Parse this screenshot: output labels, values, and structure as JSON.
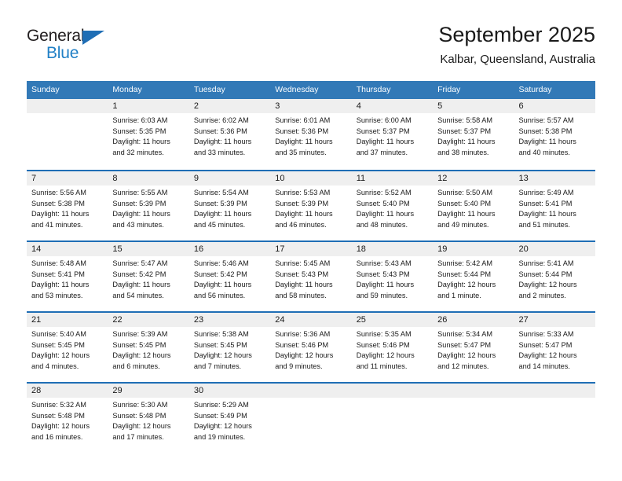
{
  "brand": {
    "name_top": "General",
    "name_bottom": "Blue",
    "color_dark": "#231f20",
    "color_blue": "#2180c6"
  },
  "header": {
    "title": "September 2025",
    "subtitle": "Kalbar, Queensland, Australia"
  },
  "theme": {
    "header_bg": "#3279b7",
    "header_text": "#ffffff",
    "week_divider": "#1f6eb5",
    "day_number_bg": "#efefef"
  },
  "weekdays": [
    "Sunday",
    "Monday",
    "Tuesday",
    "Wednesday",
    "Thursday",
    "Friday",
    "Saturday"
  ],
  "weeks": [
    [
      {
        "day": "",
        "sunrise": "",
        "sunset": "",
        "daylight_line1": "",
        "daylight_line2": ""
      },
      {
        "day": "1",
        "sunrise": "Sunrise: 6:03 AM",
        "sunset": "Sunset: 5:35 PM",
        "daylight_line1": "Daylight: 11 hours",
        "daylight_line2": "and 32 minutes."
      },
      {
        "day": "2",
        "sunrise": "Sunrise: 6:02 AM",
        "sunset": "Sunset: 5:36 PM",
        "daylight_line1": "Daylight: 11 hours",
        "daylight_line2": "and 33 minutes."
      },
      {
        "day": "3",
        "sunrise": "Sunrise: 6:01 AM",
        "sunset": "Sunset: 5:36 PM",
        "daylight_line1": "Daylight: 11 hours",
        "daylight_line2": "and 35 minutes."
      },
      {
        "day": "4",
        "sunrise": "Sunrise: 6:00 AM",
        "sunset": "Sunset: 5:37 PM",
        "daylight_line1": "Daylight: 11 hours",
        "daylight_line2": "and 37 minutes."
      },
      {
        "day": "5",
        "sunrise": "Sunrise: 5:58 AM",
        "sunset": "Sunset: 5:37 PM",
        "daylight_line1": "Daylight: 11 hours",
        "daylight_line2": "and 38 minutes."
      },
      {
        "day": "6",
        "sunrise": "Sunrise: 5:57 AM",
        "sunset": "Sunset: 5:38 PM",
        "daylight_line1": "Daylight: 11 hours",
        "daylight_line2": "and 40 minutes."
      }
    ],
    [
      {
        "day": "7",
        "sunrise": "Sunrise: 5:56 AM",
        "sunset": "Sunset: 5:38 PM",
        "daylight_line1": "Daylight: 11 hours",
        "daylight_line2": "and 41 minutes."
      },
      {
        "day": "8",
        "sunrise": "Sunrise: 5:55 AM",
        "sunset": "Sunset: 5:39 PM",
        "daylight_line1": "Daylight: 11 hours",
        "daylight_line2": "and 43 minutes."
      },
      {
        "day": "9",
        "sunrise": "Sunrise: 5:54 AM",
        "sunset": "Sunset: 5:39 PM",
        "daylight_line1": "Daylight: 11 hours",
        "daylight_line2": "and 45 minutes."
      },
      {
        "day": "10",
        "sunrise": "Sunrise: 5:53 AM",
        "sunset": "Sunset: 5:39 PM",
        "daylight_line1": "Daylight: 11 hours",
        "daylight_line2": "and 46 minutes."
      },
      {
        "day": "11",
        "sunrise": "Sunrise: 5:52 AM",
        "sunset": "Sunset: 5:40 PM",
        "daylight_line1": "Daylight: 11 hours",
        "daylight_line2": "and 48 minutes."
      },
      {
        "day": "12",
        "sunrise": "Sunrise: 5:50 AM",
        "sunset": "Sunset: 5:40 PM",
        "daylight_line1": "Daylight: 11 hours",
        "daylight_line2": "and 49 minutes."
      },
      {
        "day": "13",
        "sunrise": "Sunrise: 5:49 AM",
        "sunset": "Sunset: 5:41 PM",
        "daylight_line1": "Daylight: 11 hours",
        "daylight_line2": "and 51 minutes."
      }
    ],
    [
      {
        "day": "14",
        "sunrise": "Sunrise: 5:48 AM",
        "sunset": "Sunset: 5:41 PM",
        "daylight_line1": "Daylight: 11 hours",
        "daylight_line2": "and 53 minutes."
      },
      {
        "day": "15",
        "sunrise": "Sunrise: 5:47 AM",
        "sunset": "Sunset: 5:42 PM",
        "daylight_line1": "Daylight: 11 hours",
        "daylight_line2": "and 54 minutes."
      },
      {
        "day": "16",
        "sunrise": "Sunrise: 5:46 AM",
        "sunset": "Sunset: 5:42 PM",
        "daylight_line1": "Daylight: 11 hours",
        "daylight_line2": "and 56 minutes."
      },
      {
        "day": "17",
        "sunrise": "Sunrise: 5:45 AM",
        "sunset": "Sunset: 5:43 PM",
        "daylight_line1": "Daylight: 11 hours",
        "daylight_line2": "and 58 minutes."
      },
      {
        "day": "18",
        "sunrise": "Sunrise: 5:43 AM",
        "sunset": "Sunset: 5:43 PM",
        "daylight_line1": "Daylight: 11 hours",
        "daylight_line2": "and 59 minutes."
      },
      {
        "day": "19",
        "sunrise": "Sunrise: 5:42 AM",
        "sunset": "Sunset: 5:44 PM",
        "daylight_line1": "Daylight: 12 hours",
        "daylight_line2": "and 1 minute."
      },
      {
        "day": "20",
        "sunrise": "Sunrise: 5:41 AM",
        "sunset": "Sunset: 5:44 PM",
        "daylight_line1": "Daylight: 12 hours",
        "daylight_line2": "and 2 minutes."
      }
    ],
    [
      {
        "day": "21",
        "sunrise": "Sunrise: 5:40 AM",
        "sunset": "Sunset: 5:45 PM",
        "daylight_line1": "Daylight: 12 hours",
        "daylight_line2": "and 4 minutes."
      },
      {
        "day": "22",
        "sunrise": "Sunrise: 5:39 AM",
        "sunset": "Sunset: 5:45 PM",
        "daylight_line1": "Daylight: 12 hours",
        "daylight_line2": "and 6 minutes."
      },
      {
        "day": "23",
        "sunrise": "Sunrise: 5:38 AM",
        "sunset": "Sunset: 5:45 PM",
        "daylight_line1": "Daylight: 12 hours",
        "daylight_line2": "and 7 minutes."
      },
      {
        "day": "24",
        "sunrise": "Sunrise: 5:36 AM",
        "sunset": "Sunset: 5:46 PM",
        "daylight_line1": "Daylight: 12 hours",
        "daylight_line2": "and 9 minutes."
      },
      {
        "day": "25",
        "sunrise": "Sunrise: 5:35 AM",
        "sunset": "Sunset: 5:46 PM",
        "daylight_line1": "Daylight: 12 hours",
        "daylight_line2": "and 11 minutes."
      },
      {
        "day": "26",
        "sunrise": "Sunrise: 5:34 AM",
        "sunset": "Sunset: 5:47 PM",
        "daylight_line1": "Daylight: 12 hours",
        "daylight_line2": "and 12 minutes."
      },
      {
        "day": "27",
        "sunrise": "Sunrise: 5:33 AM",
        "sunset": "Sunset: 5:47 PM",
        "daylight_line1": "Daylight: 12 hours",
        "daylight_line2": "and 14 minutes."
      }
    ],
    [
      {
        "day": "28",
        "sunrise": "Sunrise: 5:32 AM",
        "sunset": "Sunset: 5:48 PM",
        "daylight_line1": "Daylight: 12 hours",
        "daylight_line2": "and 16 minutes."
      },
      {
        "day": "29",
        "sunrise": "Sunrise: 5:30 AM",
        "sunset": "Sunset: 5:48 PM",
        "daylight_line1": "Daylight: 12 hours",
        "daylight_line2": "and 17 minutes."
      },
      {
        "day": "30",
        "sunrise": "Sunrise: 5:29 AM",
        "sunset": "Sunset: 5:49 PM",
        "daylight_line1": "Daylight: 12 hours",
        "daylight_line2": "and 19 minutes."
      },
      {
        "day": "",
        "sunrise": "",
        "sunset": "",
        "daylight_line1": "",
        "daylight_line2": ""
      },
      {
        "day": "",
        "sunrise": "",
        "sunset": "",
        "daylight_line1": "",
        "daylight_line2": ""
      },
      {
        "day": "",
        "sunrise": "",
        "sunset": "",
        "daylight_line1": "",
        "daylight_line2": ""
      },
      {
        "day": "",
        "sunrise": "",
        "sunset": "",
        "daylight_line1": "",
        "daylight_line2": ""
      }
    ]
  ]
}
